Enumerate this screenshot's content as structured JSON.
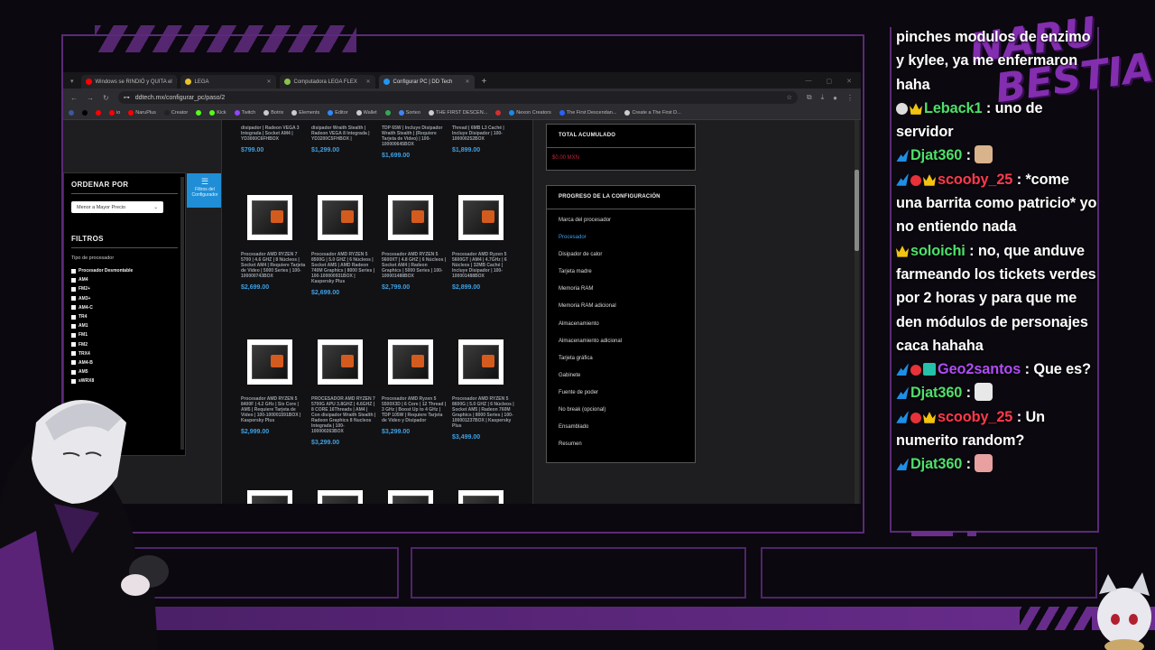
{
  "browser": {
    "tabs": [
      {
        "label": "Windows se RINDIÓ y QUITA el",
        "color": "#ff0000"
      },
      {
        "label": "LEGA",
        "color": "#e8c22b"
      },
      {
        "label": "Computadora LEGA FLEX",
        "color": "#8bc34a"
      },
      {
        "label": "Configurar PC | DD Tech",
        "color": "#2196f3",
        "active": true
      }
    ],
    "url": "ddtech.mx/configurar_pc/paso/2",
    "bookmarks": [
      {
        "label": "",
        "color": "#3b5998"
      },
      {
        "label": "",
        "color": "#000000"
      },
      {
        "label": "",
        "color": "#ff0000"
      },
      {
        "label": "io",
        "color": "#ff0000"
      },
      {
        "label": "NaruPlus",
        "color": "#ff0000"
      },
      {
        "label": "Creator",
        "color": "#222222"
      },
      {
        "label": "",
        "color": "#53fc18"
      },
      {
        "label": "Kick",
        "color": "#53fc18"
      },
      {
        "label": "Twitch",
        "color": "#9146ff"
      },
      {
        "label": "Botrix",
        "color": "#cccccc"
      },
      {
        "label": "Elements",
        "color": "#cccccc"
      },
      {
        "label": "Editor",
        "color": "#2e8bff"
      },
      {
        "label": "Wallet",
        "color": "#cccccc"
      },
      {
        "label": "",
        "color": "#34a853"
      },
      {
        "label": "Sorteo",
        "color": "#4285f4"
      },
      {
        "label": "THE FIRST DESCEN...",
        "color": "#cccccc"
      },
      {
        "label": "",
        "color": "#d32f2f"
      },
      {
        "label": "Nexon Creators",
        "color": "#1e88e5"
      },
      {
        "label": "The First Descendan...",
        "color": "#2962ff"
      },
      {
        "label": "Create a The First D...",
        "color": "#cccccc"
      }
    ]
  },
  "filters": {
    "order_title": "ORDENAR POR",
    "order_value": "Menor a Mayor Precio",
    "filters_title": "FILTROS",
    "type_label": "Tipo de procesador",
    "options": [
      "Procesador Desmontable",
      "AM4",
      "FM2+",
      "AM3+",
      "AM4-C",
      "TR4",
      "AM1",
      "FM1",
      "FM2",
      "TRX4",
      "AM4-B",
      "AM5",
      "sWRX8"
    ],
    "button_label": "Filtros del Configurador"
  },
  "products_top": [
    {
      "name": "disipador | Radeon VEGA 3 Integrada | Socket AM4 | YD3000C6FHBOX",
      "price": "$799.00"
    },
    {
      "name": "disipador Wraith Stealth | Radeon VEGA 8 Integrada | YD3200C5FHBOX |",
      "price": "$1,299.00"
    },
    {
      "name": "TDP 65W | Incluye Disipador Wraith Stealth | (Requiere Tarjeta de Video) | 100-100000645BOX",
      "price": "$1,699.00"
    },
    {
      "name": "Thread | 6MB L3 Caché | Incluye Disipador | 100-100000252BOX",
      "price": "$1,899.00"
    }
  ],
  "products": [
    {
      "name": "Procesador AMD RYZEN 7 5700 | 4.6 GHZ | 8 Núcleos | Socket AM4 | Requiere Tarjeta de Video | 5000 Series | 100-100000743BOX",
      "price": "$2,699.00"
    },
    {
      "name": "Procesador AMD RYZEN 5 8500G | 5.0 GHZ | 6 Núcleos | Socket AM5 | AMD Radeon 740M Graphics | 8000 Series | 100-100000931BOX | Kaspersky Plus",
      "price": "$2,699.00"
    },
    {
      "name": "Procesador AMD RYZEN 5 5600XT | 4.8 GHZ | 6 Núcleos | Socket AM4 | Radeon Graphics | 5000 Series | 100-100001488BOX",
      "price": "$2,799.00"
    },
    {
      "name": "Procesador AMD Ryzen 5 5600GT | AM4 | 4.7GHz | 6 Núcleos | 32MB Caché | Incluye Disipador | 100-100001488BOX",
      "price": "$2,899.00"
    },
    {
      "name": "Procesador AMD RYZEN 5 8400F | 4.2 GHz | Six Core | AM5 | Requiere Tarjeta de Video | 100-100001591BOX | Kaspersky Plus",
      "price": "$2,999.00"
    },
    {
      "name": "PROCESADOR AMD RYZEN 7 5700G APU 3.8GHZ | 4.6GHZ | 8 CORE 16Threads | AM4 | Con disipador Wraith Stealth | Radeon Graphics 8 Nucleos Integrada | 100-100000263BOX",
      "price": "$3,299.00"
    },
    {
      "name": "Procesador AMD Ryzen 5 5500X3D | 6 Core | 12 Thread | 3 GHz | Boost Up to 4 GHz | TDP 105W | Requiere Tarjeta de Video y Disipador",
      "price": "$3,299.00"
    },
    {
      "name": "Procesador AMD RYZEN 5 8600G | 5.0 GHZ | 6 Núcleos | Socket AM5 | Radeon 760M Graphics | 8000 Series | 100-100001237BOX | Kaspersky Plus",
      "price": "$3,499.00"
    }
  ],
  "summary": {
    "total_title": "TOTAL ACUMULADO",
    "total_value": "$0.00 MXN",
    "progress_title": "PROGRESO DE LA CONFIGURACIÓN",
    "steps": [
      "Marca del procesador",
      "Procesador",
      "Disipador de calor",
      "Tarjeta madre",
      "Memoria RAM",
      "Memoria RAM adicional",
      "Almacenamiento",
      "Almacenamiento adicional",
      "Tarjeta gráfica",
      "Gabinete",
      "Fuente de poder",
      "No break (opcional)",
      "Ensamblado",
      "Resumen"
    ],
    "current_step": 1
  },
  "chat": [
    {
      "badges": [],
      "user": "",
      "color": "#ffffff",
      "text": "pinches modulos de enzimo y kylee, ya me enfermaron haha"
    },
    {
      "badges": [
        "white",
        "crown"
      ],
      "user": "Leback1",
      "color": "#4ee06a",
      "text": "uno de servidor"
    },
    {
      "badges": [
        "prime"
      ],
      "user": "Djat360",
      "color": "#4ee06a",
      "text": "",
      "emote": "#d9b38c"
    },
    {
      "badges": [
        "prime",
        "red",
        "crown"
      ],
      "user": "scooby_25",
      "color": "#ff3a4c",
      "text": "*come una barrita como patricio* yo no entiendo nada"
    },
    {
      "badges": [
        "crown"
      ],
      "user": "soloichi",
      "color": "#4ee06a",
      "text": "no, que anduve farmeando los tickets verdes por 2 horas y para que me den módulos de personajes caca hahaha"
    },
    {
      "badges": [
        "prime",
        "red",
        "gg"
      ],
      "user": "Geo2santos",
      "color": "#b04cf5",
      "text": "Que es?"
    },
    {
      "badges": [
        "prime"
      ],
      "user": "Djat360",
      "color": "#4ee06a",
      "text": "",
      "emote": "#e8e8e8"
    },
    {
      "badges": [
        "prime",
        "red",
        "crown"
      ],
      "user": "scooby_25",
      "color": "#ff3a4c",
      "text": "Un numerito random?"
    },
    {
      "badges": [
        "prime"
      ],
      "user": "Djat360",
      "color": "#4ee06a",
      "text": "",
      "emote": "#e8a0a0"
    }
  ],
  "logo": {
    "line1": "NARU",
    "line2": "BESTIA"
  },
  "colors": {
    "accent": "#5b2a78",
    "link": "#3ea0e4",
    "price": "#3ea0e4",
    "total": "#c2263a"
  }
}
